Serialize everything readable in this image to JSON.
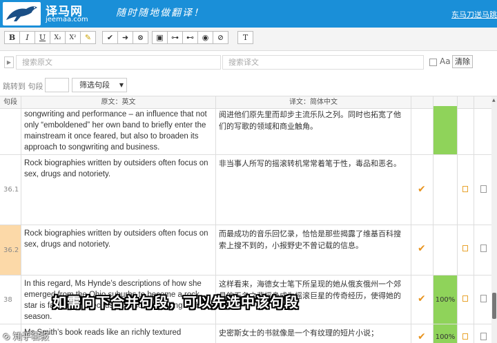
{
  "header": {
    "logo_text": "译马网",
    "logo_domain": "jeemaa.com",
    "slogan": "随时随地做翻译！",
    "user_link": "东马刀送马跳",
    "colors": {
      "bar": "#1a8fd8"
    }
  },
  "toolbar": {
    "buttons": [
      {
        "label": "B",
        "icon": "bold-icon"
      },
      {
        "label": "I",
        "icon": "italic-icon"
      },
      {
        "label": "U",
        "icon": "underline-icon"
      },
      {
        "label": "X₂",
        "icon": "subscript-icon"
      },
      {
        "label": "X²",
        "icon": "superscript-icon"
      },
      {
        "label": "✎",
        "icon": "clear-format-icon"
      },
      {
        "label": "✔",
        "icon": "confirm-icon"
      },
      {
        "label": "➜",
        "icon": "arrow-right-icon"
      },
      {
        "label": "⊗",
        "icon": "close-circle-icon"
      },
      {
        "label": "▣",
        "icon": "copy-source-icon"
      },
      {
        "label": "⊶",
        "icon": "merge-icon"
      },
      {
        "label": "⊷",
        "icon": "link-icon"
      },
      {
        "label": "◉",
        "icon": "eye-icon"
      },
      {
        "label": "⊘",
        "icon": "eye-off-icon"
      },
      {
        "label": "T",
        "icon": "text-plus-icon"
      }
    ]
  },
  "search": {
    "source_placeholder": "搜索原文",
    "target_placeholder": "搜索译文",
    "case_label": "Aa",
    "clear_label": "清除"
  },
  "jump": {
    "label": "跳转到 句段",
    "filter_label": "筛选句段"
  },
  "table": {
    "headers": {
      "id": "句段",
      "source": "原文：英文",
      "target": "译文：简体中文"
    },
    "rows": [
      {
        "id": "",
        "source": "songwriting and performance – an influence that not only “emboldened” her own band to briefly enter the mainstream it once feared, but also to broaden its approach to songwriting and business.",
        "target": "阅进他们原先里而却步主流乐队之列。同时也拓宽了他们的写歌的领域和商业触角。",
        "pct": "",
        "checked": false
      },
      {
        "id": "36.1",
        "source": "Rock biographies written by outsiders often focus on sex, drugs and notoriety.",
        "target": "非当事人所写的摇滚转机常常着笔于性，毒品和恶名。",
        "pct": "",
        "checked": true
      },
      {
        "id": "36.2",
        "source": "Rock biographies written by outsiders often focus on sex, drugs and notoriety.",
        "target": "而最成功的音乐回忆录，恰恰是那些揭露了维基百科搜索上搜不到的，小报野史不曾记载的信息。",
        "pct": "",
        "checked": true
      },
      {
        "id": "38",
        "source": "In this regard, Ms Hynde’s descriptions of how she emerged from the Ohio suburbs to become a rock star is fascinating because it is so compelling of the season.",
        "target": "这样看来，海德女士笔下所呈现的她从俄亥俄州一个郊县的无名之辈摇身成为摇滚巨星的传奇经历，使得她的",
        "pct": "100%",
        "checked": true
      },
      {
        "id": "",
        "source": "Ms Smith’s book reads like an richly textured",
        "target": "史密斯女士的书就像是一个有纹理的短片小说；",
        "pct": "100%",
        "checked": true
      }
    ]
  },
  "caption": "如需向下合并句段，可以先选中该句段",
  "watermark": "⊙ 知乎日报"
}
